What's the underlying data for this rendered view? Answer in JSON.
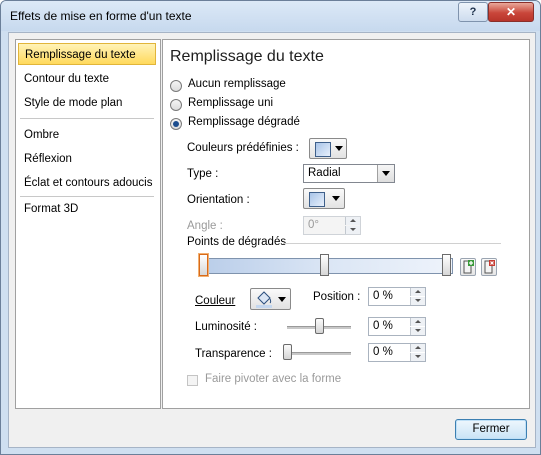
{
  "window": {
    "title": "Effets de mise en forme d'un texte",
    "help_label": "?",
    "close_label": "✕"
  },
  "sidebar": {
    "items": [
      {
        "label": "Remplissage du texte",
        "selected": true
      },
      {
        "label": "Contour du texte"
      },
      {
        "label": "Style de mode plan"
      },
      {
        "label": "Ombre"
      },
      {
        "label": "Réflexion"
      },
      {
        "label": "Éclat et contours adoucis"
      },
      {
        "label": "Format 3D"
      }
    ]
  },
  "panel": {
    "title": "Remplissage du texte",
    "fill_options": [
      {
        "label": "Aucun remplissage",
        "selected": false
      },
      {
        "label": "Remplissage uni",
        "selected": false
      },
      {
        "label": "Remplissage dégradé",
        "selected": true
      }
    ],
    "preset_colors_label": "Couleurs prédéfinies :",
    "type_label": "Type :",
    "type_value": "Radial",
    "orientation_label": "Orientation :",
    "angle_label": "Angle :",
    "angle_value": "0°",
    "stops_section_label": "Points de dégradés",
    "gradient_colors": [
      "#b9cde9",
      "#dbe6f5",
      "#eef3fb"
    ],
    "color_label": "Couleur",
    "position_label": "Position :",
    "position_value": "0 %",
    "brightness_label": "Luminosité :",
    "brightness_value": "0 %",
    "brightness_level": 0.5,
    "transparency_label": "Transparence :",
    "transparency_value": "0 %",
    "transparency_level": 0,
    "rotate_label": "Faire pivoter avec la forme",
    "rotate_checked": false
  },
  "footer": {
    "close_button": "Fermer"
  },
  "colors": {
    "selected_bg": "#ffd95c",
    "accent": "#1c4d8e",
    "close_red": "#c9463a"
  }
}
